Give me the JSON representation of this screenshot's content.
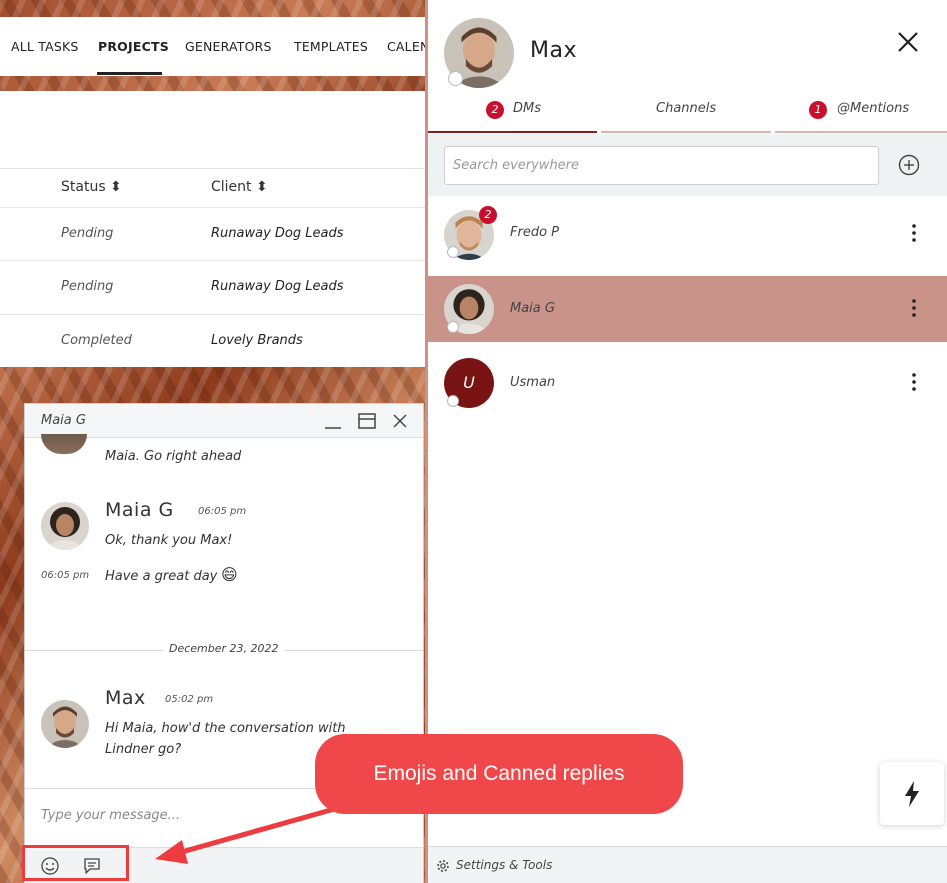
{
  "nav": {
    "items": [
      {
        "label": "ALL TASKS",
        "active": false
      },
      {
        "label": "PROJECTS",
        "active": true
      },
      {
        "label": "GENERATORS",
        "active": false
      },
      {
        "label": "TEMPLATES",
        "active": false
      },
      {
        "label": "CALEN",
        "active": false
      }
    ]
  },
  "table": {
    "columns": {
      "status": "Status ⬍",
      "client": "Client ⬍"
    },
    "rows": [
      {
        "status": "Pending",
        "client": "Runaway Dog Leads"
      },
      {
        "status": "Pending",
        "client": "Runaway Dog Leads"
      },
      {
        "status": "Completed",
        "client": "Lovely Brands"
      }
    ]
  },
  "chat": {
    "title": "Maia G",
    "partial_message": "Maia. Go right ahead",
    "messages": [
      {
        "sender": "Maia G",
        "time": "06:05 pm",
        "text": "Ok, thank you Max!"
      },
      {
        "time": "06:05 pm",
        "text": "Have a great day",
        "emoji": "😄"
      }
    ],
    "date_separator": "December 23, 2022",
    "last_message": {
      "sender": "Max",
      "time": "05:02 pm",
      "line1": "Hi Maia, how'd the conversation with",
      "line2": "Lindner go?"
    },
    "input_placeholder": "Type your message..."
  },
  "panel": {
    "user_name": "Max",
    "tabs": [
      {
        "label": "DMs",
        "badge": "2",
        "active": true
      },
      {
        "label": "Channels",
        "badge": "",
        "active": false
      },
      {
        "label": "@Mentions",
        "badge": "1",
        "active": false
      }
    ],
    "search_placeholder": "Search everywhere",
    "contacts": [
      {
        "name": "Fredo P",
        "badge": "2",
        "selected": false
      },
      {
        "name": "Maia G",
        "badge": "",
        "selected": true
      },
      {
        "name": "Usman",
        "initial": "U",
        "badge": "",
        "selected": false
      }
    ],
    "settings_label": "Settings & Tools"
  },
  "annotation": {
    "callout": "Emojis and Canned replies"
  },
  "colors": {
    "accent": "#c8102e",
    "selected_row": "#c9938a",
    "active_tab_bar": "#8a1c1c",
    "callout": "#f0484a",
    "usman_avatar": "#7a1414"
  }
}
